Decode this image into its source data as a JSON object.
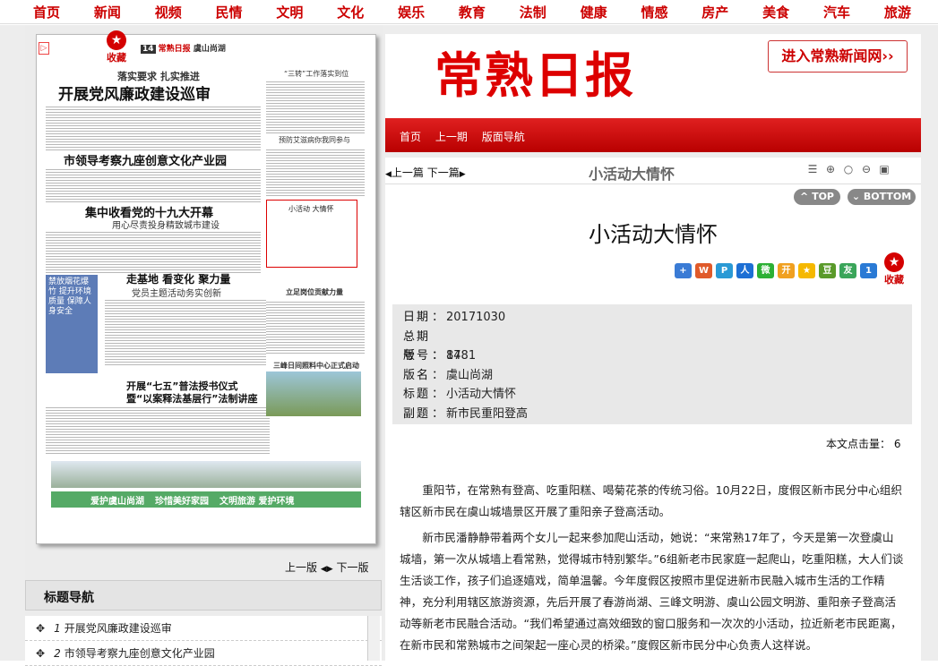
{
  "topnav": [
    "首页",
    "新闻",
    "视频",
    "民情",
    "文明",
    "文化",
    "娱乐",
    "教育",
    "法制",
    "健康",
    "情感",
    "房产",
    "美食",
    "汽车",
    "旅游"
  ],
  "brand": {
    "logo": "常熟日报",
    "enter": "进入常熟新闻网"
  },
  "section_links": [
    "首页",
    "上一期",
    "版面导航"
  ],
  "paper": {
    "page_label": "14",
    "page_name": "虞山尚湖",
    "fav_label": "收藏",
    "heads": [
      "落实要求 扎实推进",
      "开展党风廉政建设巡审",
      "市领导考察九座创意文化产业园",
      "集中收看党的十九大开幕",
      "用心尽责投身精致城市建设",
      "走基地 看变化 聚力量",
      "党员主题活动务实创新",
      "开展“七五”普法授书仪式",
      "暨“以案释法基层行”法制讲座",
      "“三转”工作落实到位",
      "预防艾滋病你我同参与",
      "小活动 大情怀",
      "立足岗位贡献力量",
      "三峰日间照料中心正式启动",
      "禁放烟花爆竹 提升环境质量 保障人身安全",
      "爱护虞山尚湖",
      "珍惜美好家园",
      "文明旅游 爱护环境"
    ]
  },
  "prevnext_left": {
    "prev": "上一版",
    "next": "下一版"
  },
  "title_nav": {
    "heading": "标题导航",
    "items": [
      {
        "num": "1",
        "title": "开展党风廉政建设巡审"
      },
      {
        "num": "2",
        "title": "市领导考察九座创意文化产业园"
      }
    ]
  },
  "toolbar": {
    "prev": "上一篇",
    "next": "下一篇",
    "title": "小活动大情怀",
    "top": "TOP",
    "bottom": "BOTTOM"
  },
  "article": {
    "title": "小活动大情怀",
    "fav": "收藏",
    "meta": [
      {
        "k": "日期",
        "v": "20171030"
      },
      {
        "k": "总期号",
        "v": "8781"
      },
      {
        "k": "版号",
        "v": "14"
      },
      {
        "k": "版名",
        "v": "虞山尚湖"
      },
      {
        "k": "标题",
        "v": "小活动大情怀"
      },
      {
        "k": "副题",
        "v": "新市民重阳登高"
      }
    ],
    "clicks_label": "本文点击量：",
    "clicks": "6",
    "paragraphs": [
      "重阳节，在常熟有登高、吃重阳糕、喝菊花茶的传统习俗。10月22日，度假区新市民分中心组织辖区新市民在虞山城墙景区开展了重阳亲子登高活动。",
      "新市民潘静静带着两个女儿一起来参加爬山活动，她说：“来常熟17年了，今天是第一次登虞山城墙，第一次从城墙上看常熟，觉得城市特别繁华。”6组新老市民家庭一起爬山，吃重阳糕，大人们谈生活谈工作，孩子们追逐嬉戏，简单温馨。今年度假区按照市里促进新市民融入城市生活的工作精神，充分利用辖区旅游资源，先后开展了春游尚湖、三峰文明游、虞山公园文明游、重阳亲子登高活动等新老市民融合活动。“我们希望通过高效细致的窗口服务和一次次的小活动，拉近新老市民距离，在新市民和常熟城市之间架起一座心灵的桥梁。”度假区新市民分中心负责人这样说。"
    ]
  },
  "share_colors": [
    "#3a7bd5",
    "#e05a2a",
    "#2a9ad5",
    "#1d6fd4",
    "#2cb035",
    "#f0a020",
    "#f5b800",
    "#5a9a2a",
    "#3aa55a",
    "#2a7ad5"
  ]
}
